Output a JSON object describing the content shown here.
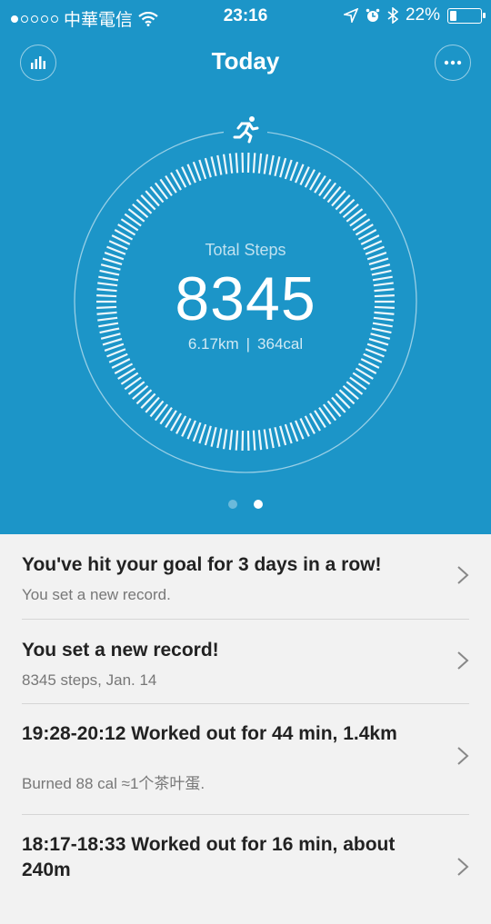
{
  "status_bar": {
    "carrier": "中華電信",
    "time": "23:16",
    "battery": "22%",
    "battery_level": 0.22,
    "signal_dots_filled": 1,
    "signal_dots_total": 5
  },
  "nav": {
    "title": "Today",
    "left_icon": "bar-chart-icon",
    "right_icon": "more-icon"
  },
  "summary": {
    "label": "Total Steps",
    "steps": "8345",
    "distance": "6.17km",
    "separator": "|",
    "calories": "364cal"
  },
  "pager": {
    "pages": 2,
    "active": 1
  },
  "feed": [
    {
      "title": "You've hit your goal for 3 days in a row!",
      "subtitle": "You set a new record."
    },
    {
      "title": "You set a new record!",
      "subtitle": "8345 steps, Jan. 14"
    },
    {
      "title": "19:28-20:12  Worked out for 44 min, 1.4km",
      "subtitle": "Burned 88 cal ≈1个茶叶蛋."
    },
    {
      "title": "18:17-18:33  Worked out for 16 min, about 240m",
      "subtitle": ""
    }
  ],
  "colors": {
    "hero_background": "#1c95c8",
    "feed_background": "#f2f2f2"
  }
}
